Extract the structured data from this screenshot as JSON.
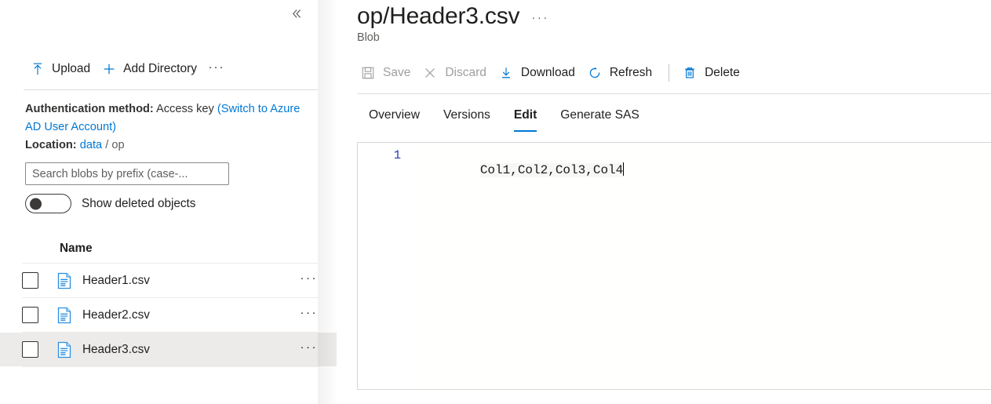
{
  "left_panel": {
    "collapse_icon": "chevron-double-left-icon",
    "toolbar": {
      "upload_label": "Upload",
      "upload_icon": "upload-arrow-icon",
      "add_directory_label": "Add Directory",
      "add_directory_icon": "plus-icon",
      "more_label": "···"
    },
    "auth": {
      "label": "Authentication method:",
      "value": "Access key",
      "switch_link": "(Switch to Azure AD User Account)"
    },
    "location": {
      "label": "Location:",
      "root": "data",
      "separator": "/",
      "current": "op"
    },
    "search": {
      "placeholder": "Search blobs by prefix (case-...",
      "value": ""
    },
    "show_deleted": {
      "label": "Show deleted objects",
      "state": "off"
    },
    "list": {
      "column_header": "Name",
      "rows": [
        {
          "name": "Header1.csv",
          "icon": "csv-file-icon",
          "checked": false,
          "selected": false,
          "menu": "···"
        },
        {
          "name": "Header2.csv",
          "icon": "csv-file-icon",
          "checked": false,
          "selected": false,
          "menu": "···"
        },
        {
          "name": "Header3.csv",
          "icon": "csv-file-icon",
          "checked": false,
          "selected": true,
          "menu": "···"
        }
      ]
    }
  },
  "right_panel": {
    "title": "op/Header3.csv",
    "title_menu": "···",
    "subtitle": "Blob",
    "toolbar": {
      "save_label": "Save",
      "save_icon": "save-disk-icon",
      "save_enabled": false,
      "discard_label": "Discard",
      "discard_icon": "close-x-icon",
      "discard_enabled": false,
      "download_label": "Download",
      "download_icon": "download-arrow-icon",
      "download_enabled": true,
      "refresh_label": "Refresh",
      "refresh_icon": "refresh-circle-icon",
      "refresh_enabled": true,
      "delete_label": "Delete",
      "delete_icon": "trash-bin-icon",
      "delete_enabled": true
    },
    "tabs": [
      {
        "label": "Overview",
        "active": false
      },
      {
        "label": "Versions",
        "active": false
      },
      {
        "label": "Edit",
        "active": true
      },
      {
        "label": "Generate SAS",
        "active": false
      }
    ],
    "editor": {
      "line_numbers": [
        "1"
      ],
      "lines": [
        "Col1,Col2,Col3,Col4"
      ]
    }
  },
  "colors": {
    "accent": "#0078d4",
    "link": "#0078d4",
    "text": "#201f1e",
    "muted": "#605e5c",
    "disabled": "#a19f9d",
    "selected_row": "#edebe9",
    "divider": "#e1dfdd",
    "line_number": "#2b3bb5"
  }
}
